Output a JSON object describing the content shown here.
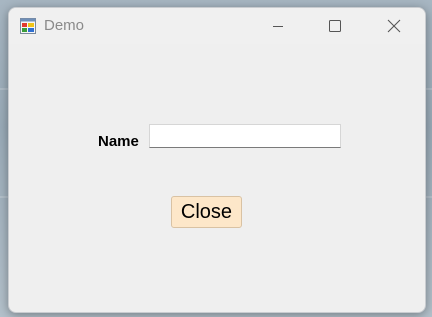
{
  "window": {
    "title": "Demo"
  },
  "form": {
    "name_label": "Name",
    "name_value": "",
    "close_label": "Close"
  },
  "icons": {
    "app": "app-window-icon",
    "minimize": "minimize-icon",
    "maximize": "maximize-icon",
    "close": "close-icon"
  },
  "colors": {
    "close_button_bg": "#fde7c9",
    "window_bg": "#efefef"
  }
}
